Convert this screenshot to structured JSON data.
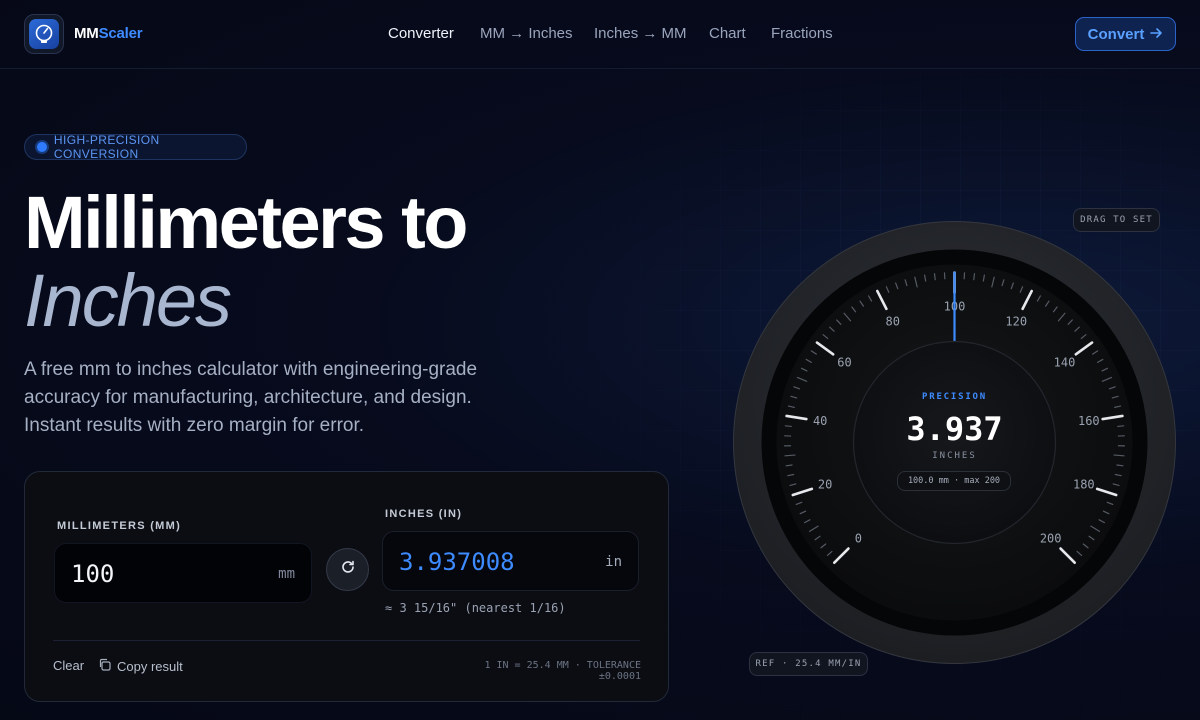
{
  "brand": {
    "name_a": "MM",
    "name_b": "Scaler",
    "logo_icon": "gauge-icon"
  },
  "nav": [
    {
      "label": "Converter",
      "active": true
    },
    {
      "label": "MM → Inches",
      "active": false
    },
    {
      "label": "Inches → MM",
      "active": false
    },
    {
      "label": "Chart",
      "active": false
    },
    {
      "label": "Fractions",
      "active": false
    }
  ],
  "cta": {
    "label": "Convert",
    "icon": "arrow-right-icon"
  },
  "hero": {
    "badge": "HIGH-PRECISION CONVERSION",
    "title_line1": "Millimeters to",
    "title_line2": "Inches",
    "lead": "A free mm to inches calculator with engineering-grade accuracy for manufacturing, architecture, and design. Instant results with zero margin for error."
  },
  "converter": {
    "mm_label": "MILLIMETERS (MM)",
    "mm_value": "100",
    "mm_unit": "mm",
    "in_label": "INCHES (IN)",
    "in_value": "3.937008",
    "in_unit": "in",
    "swap_icon": "refresh-icon",
    "approx": "≈ 3 15/16\" (nearest 1/16)",
    "clear_label": "Clear",
    "copy_label": "Copy result",
    "copy_icon": "copy-icon",
    "tolerance": "1 IN = 25.4 MM · TOLERANCE ±0.0001"
  },
  "dial": {
    "drag_hint": "DRAG TO SET",
    "ref": "REF · 25.4 MM/IN",
    "precision_label": "PRECISION",
    "value": "3.937",
    "unit": "INCHES",
    "range_note": "100.0 mm · max 200",
    "current_mm": 100,
    "min": 0,
    "max": 200,
    "scale_labels": [
      "0",
      "20",
      "40",
      "60",
      "80",
      "100",
      "120",
      "140",
      "160",
      "180",
      "200"
    ]
  },
  "colors": {
    "accent": "#3d8bff",
    "background": "#060a1a",
    "card": "#0b0d13"
  }
}
